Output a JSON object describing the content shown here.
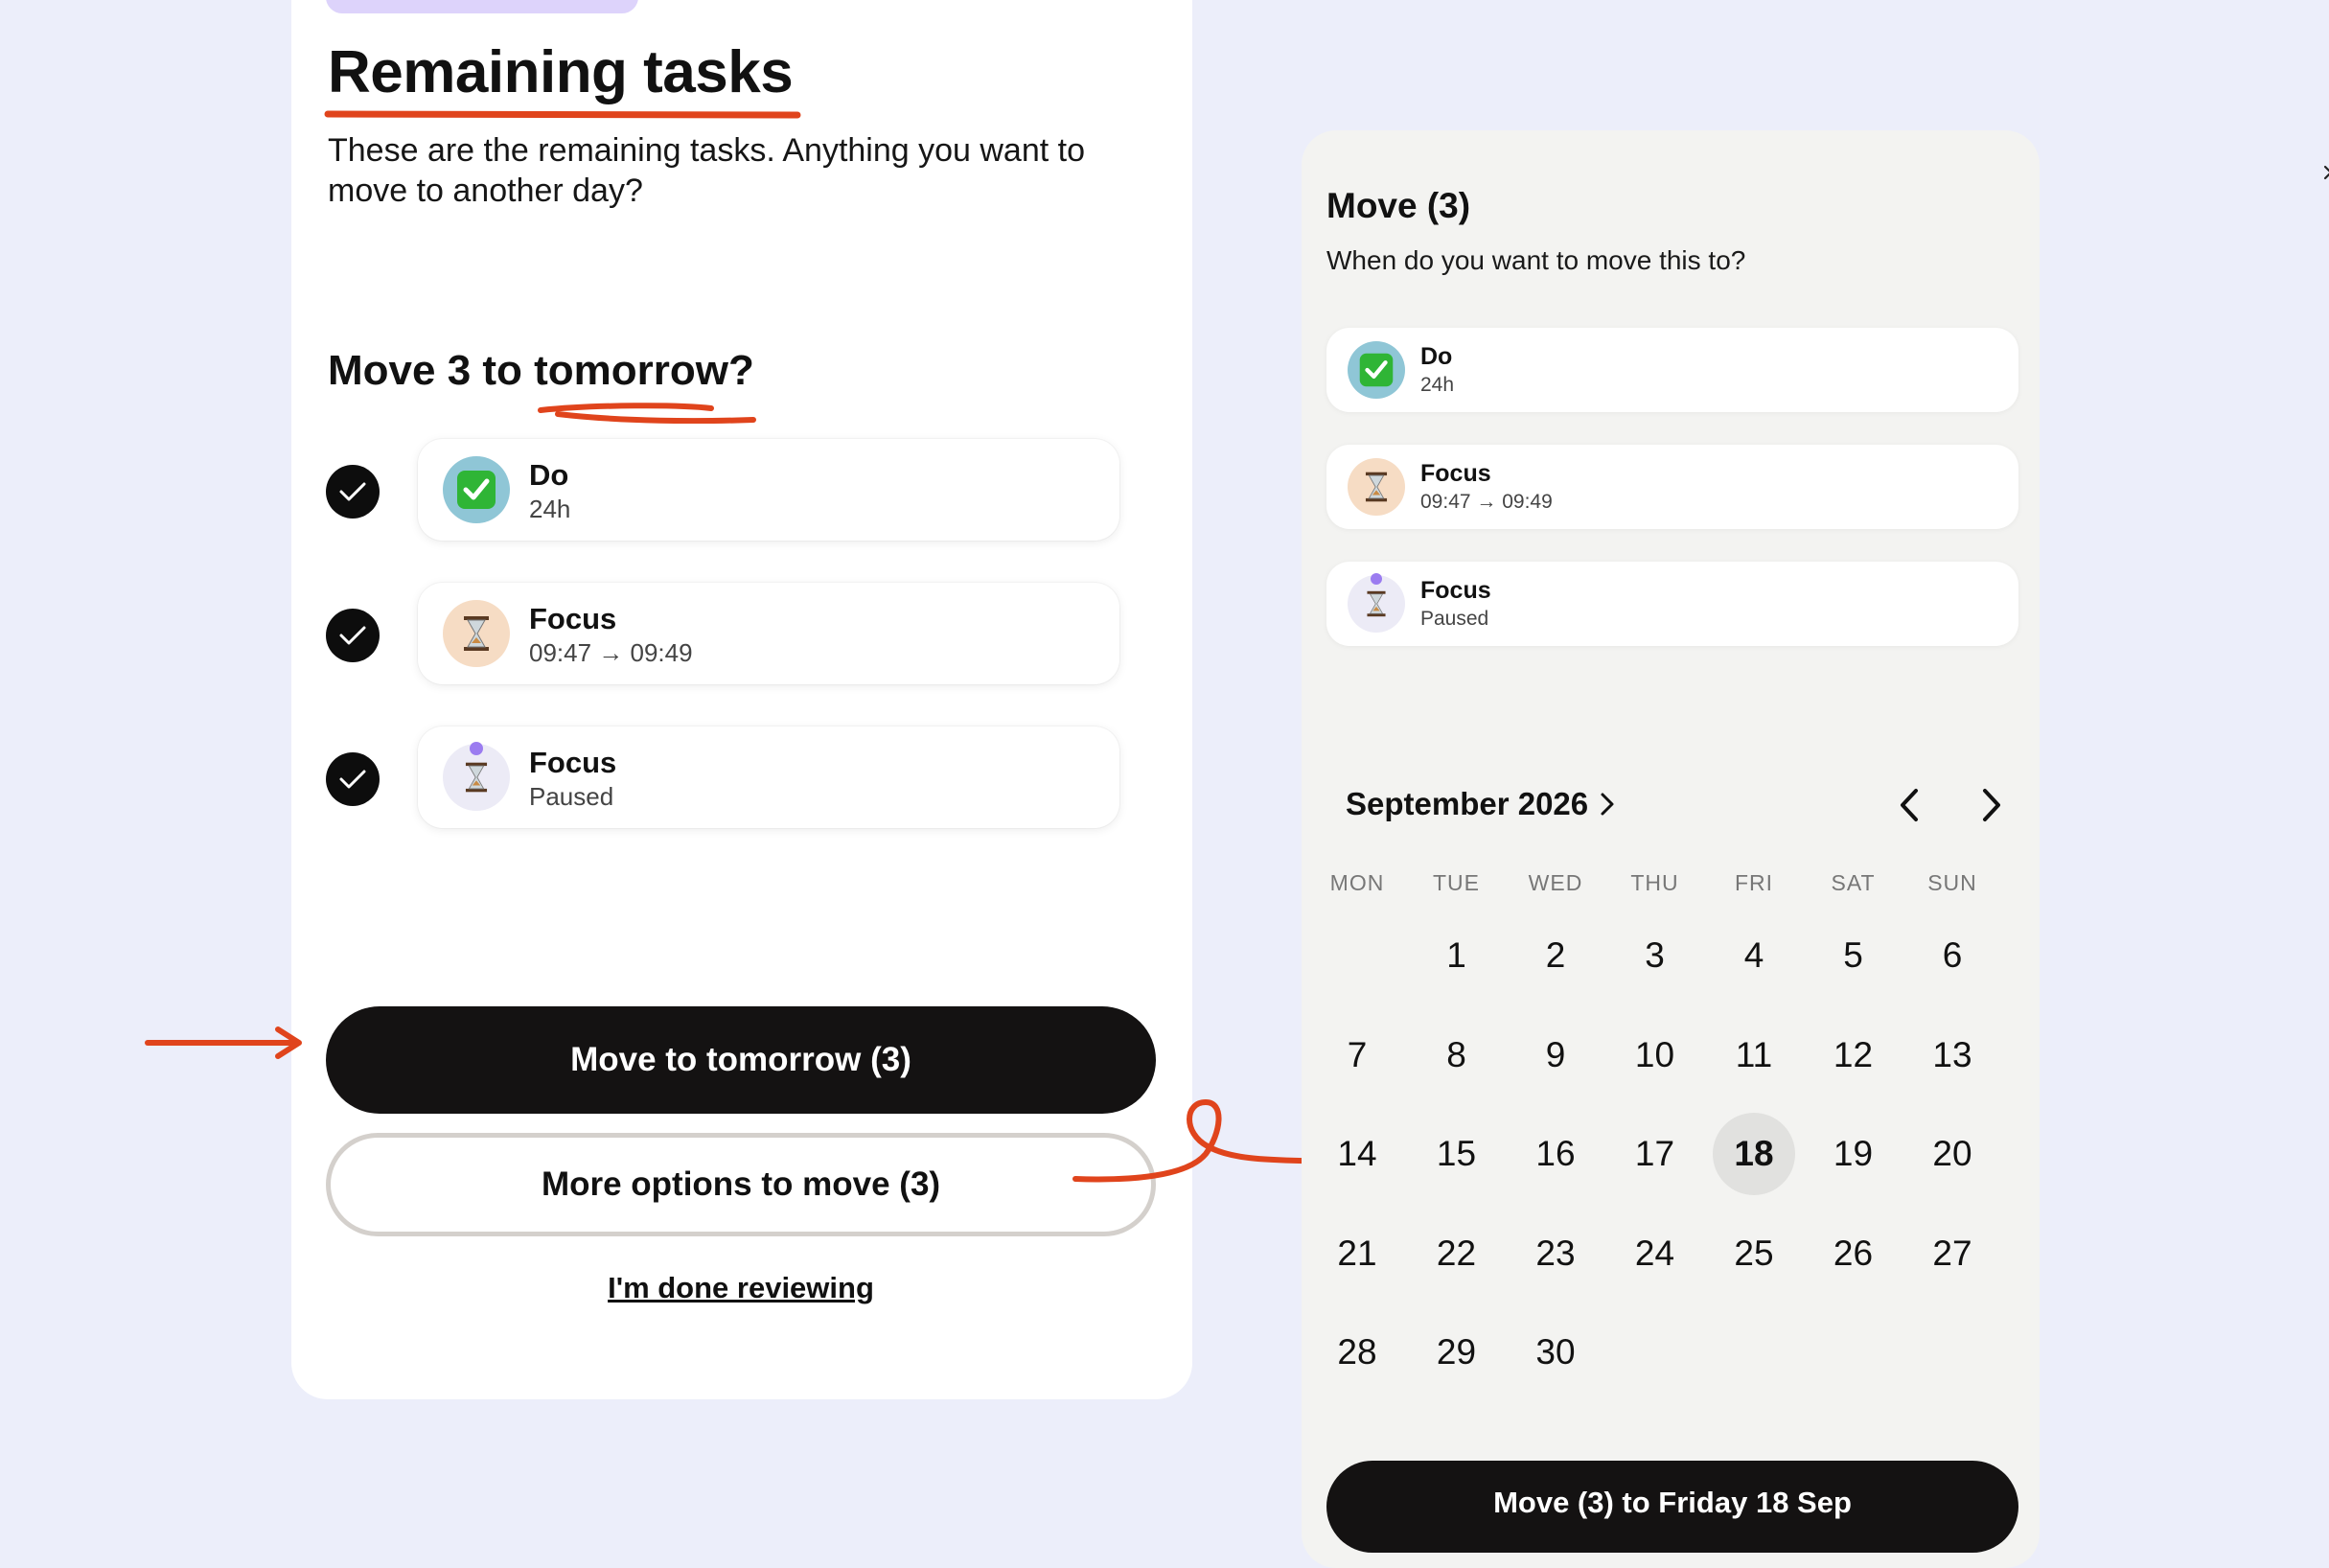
{
  "colors": {
    "background": "#eceefa",
    "accent_annotation": "#e0441c",
    "primary_button": "#141212",
    "pill": "#ddd3fb"
  },
  "left": {
    "title": "Remaining tasks",
    "intro": "These are the remaining tasks. Anything you want to move to another day?",
    "subtitle": "Move 3 to tomorrow?",
    "tasks": [
      {
        "name": "Do",
        "detail": "24h",
        "icon": "check-box-icon"
      },
      {
        "name": "Focus",
        "detail": "09:47 → 09:49",
        "icon": "hourglass-icon"
      },
      {
        "name": "Focus",
        "detail": "Paused",
        "icon": "hourglass-paused-icon"
      }
    ],
    "primary_button": "Move to tomorrow (3)",
    "secondary_button": "More options to move (3)",
    "done_link": "I'm done reviewing"
  },
  "panel": {
    "title": "Move (3)",
    "question": "When do you want to move this to?",
    "tasks": [
      {
        "name": "Do",
        "detail": "24h",
        "icon": "check-box-icon"
      },
      {
        "name": "Focus",
        "detail": "09:47 → 09:49",
        "icon": "hourglass-icon"
      },
      {
        "name": "Focus",
        "detail": "Paused",
        "icon": "hourglass-paused-icon"
      }
    ],
    "calendar": {
      "month_label": "September 2026",
      "weekdays": [
        "MON",
        "TUE",
        "WED",
        "THU",
        "FRI",
        "SAT",
        "SUN"
      ],
      "first_weekday_index": 1,
      "days_in_month": 30,
      "selected_day": 18
    },
    "confirm_button": "Move (3) to Friday 18 Sep"
  }
}
